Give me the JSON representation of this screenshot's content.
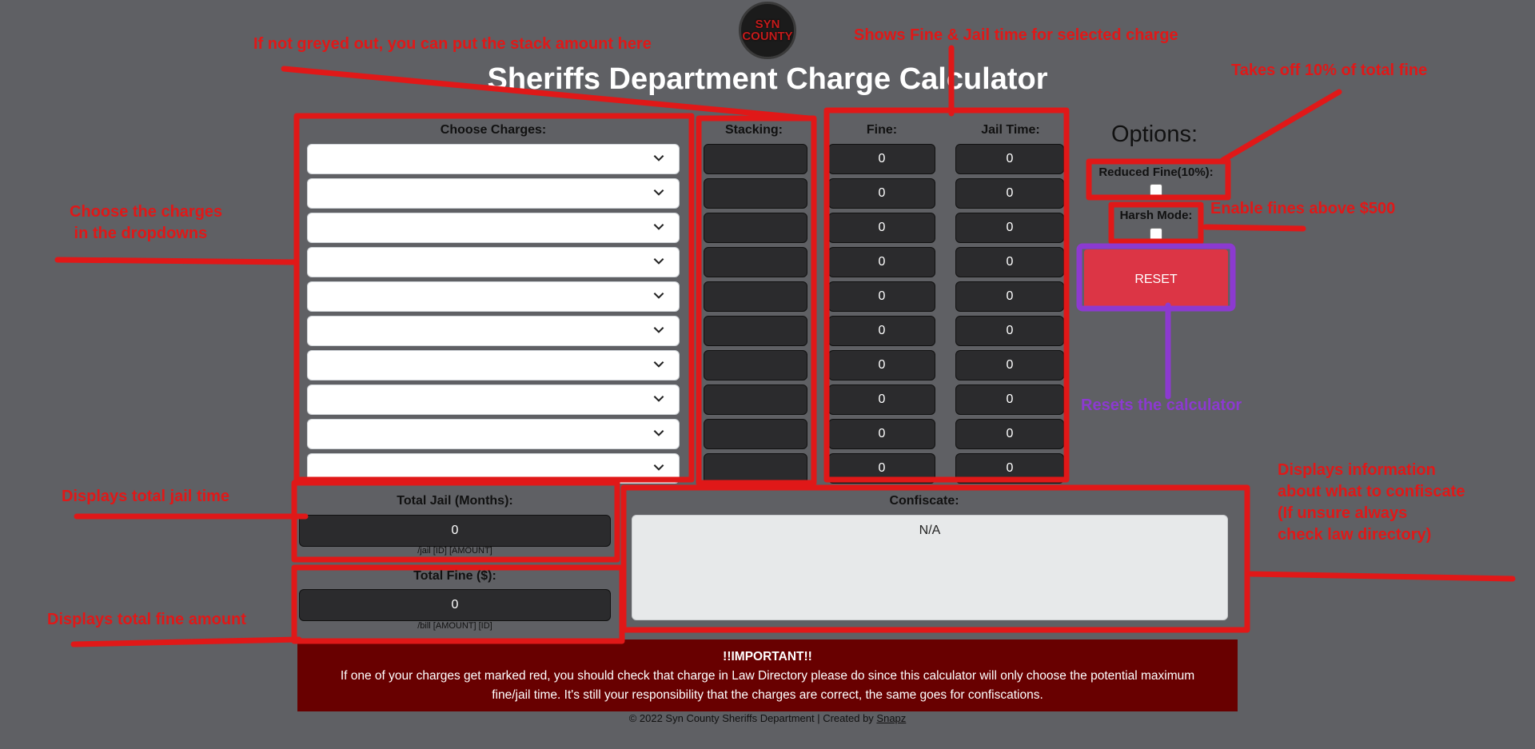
{
  "logo": {
    "text": "SYN COUNTY"
  },
  "title": "Sheriffs Department Charge Calculator",
  "columns": {
    "charges": "Choose Charges:",
    "stacking": "Stacking:",
    "fine": "Fine:",
    "jail": "Jail Time:"
  },
  "rows": [
    {
      "fine": "0",
      "jail": "0"
    },
    {
      "fine": "0",
      "jail": "0"
    },
    {
      "fine": "0",
      "jail": "0"
    },
    {
      "fine": "0",
      "jail": "0"
    },
    {
      "fine": "0",
      "jail": "0"
    },
    {
      "fine": "0",
      "jail": "0"
    },
    {
      "fine": "0",
      "jail": "0"
    },
    {
      "fine": "0",
      "jail": "0"
    },
    {
      "fine": "0",
      "jail": "0"
    },
    {
      "fine": "0",
      "jail": "0"
    }
  ],
  "options": {
    "title": "Options:",
    "reduced_fine_label": "Reduced Fine(10%):",
    "harsh_mode_label": "Harsh Mode:",
    "reset_label": "RESET"
  },
  "totals": {
    "jail_label": "Total Jail (Months):",
    "jail_value": "0",
    "jail_hint": "/jail [ID] [AMOUNT]",
    "fine_label": "Total Fine ($):",
    "fine_value": "0",
    "fine_hint": "/bill [AMOUNT] [ID]"
  },
  "confiscate": {
    "label": "Confiscate:",
    "value": "N/A"
  },
  "important": {
    "heading": "!!IMPORTANT!!",
    "line1": "If one of your charges get marked red, you should check that charge in Law Directory please do since this calculator will only choose the potential maximum",
    "line2": "fine/jail time. It's still your responsibility that the charges are correct, the same goes for confiscations."
  },
  "footer": {
    "text": "© 2022 Syn County Sheriffs Department | Created by ",
    "link": "Snapz"
  },
  "annotations": {
    "stack": "If not greyed out, you can put the stack amount here",
    "fine_jail": "Shows Fine & Jail time for selected charge",
    "reduced": "Takes off 10% of total fine",
    "choose_1": "Choose the charges",
    "choose_2": " in the dropdowns",
    "harsh": "Enable fines above $500",
    "reset": "Resets the calculator",
    "total_jail": "Displays total jail time",
    "total_fine": "Displays total fine amount",
    "confiscate_1": "Displays information",
    "confiscate_2": "about what to confiscate",
    "confiscate_3": "(If unsure always",
    "confiscate_4": "check law directory)"
  },
  "colors": {
    "background": "#5f6064",
    "annotation_red": "#e01818",
    "annotation_purple": "#8c3ad0",
    "reset": "#dc3545",
    "important_bg": "#680000"
  }
}
